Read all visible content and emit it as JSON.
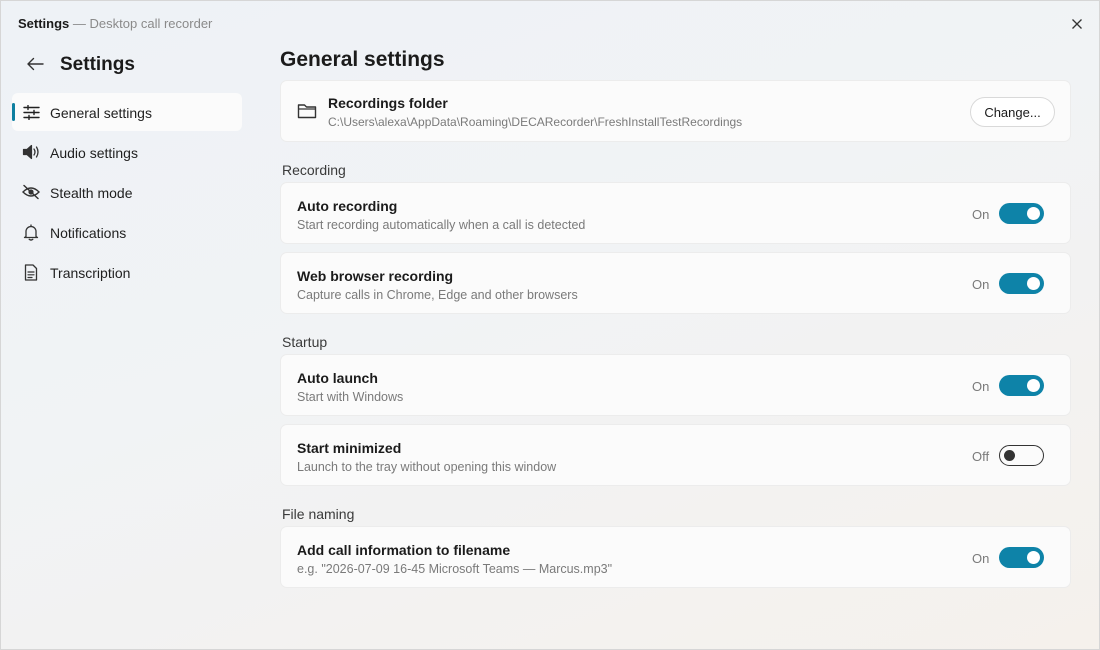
{
  "window": {
    "app_name": "Settings",
    "separator": "—",
    "subtitle": "Desktop call recorder"
  },
  "sidebar": {
    "title": "Settings",
    "items": [
      {
        "label": "General settings",
        "icon": "sliders-icon",
        "active": true
      },
      {
        "label": "Audio settings",
        "icon": "speaker-icon",
        "active": false
      },
      {
        "label": "Stealth mode",
        "icon": "eye-off-icon",
        "active": false
      },
      {
        "label": "Notifications",
        "icon": "bell-icon",
        "active": false
      },
      {
        "label": "Transcription",
        "icon": "document-icon",
        "active": false
      }
    ]
  },
  "main": {
    "title": "General settings",
    "folder": {
      "title": "Recordings folder",
      "path": "C:\\Users\\alexa\\AppData\\Roaming\\DECARecorder\\FreshInstallTestRecordings",
      "button": "Change..."
    },
    "sections": [
      {
        "label": "Recording",
        "items": [
          {
            "title": "Auto recording",
            "description": "Start recording automatically when a call is detected",
            "state": "On",
            "enabled": true
          },
          {
            "title": "Web browser recording",
            "description": "Capture calls in Chrome, Edge and other browsers",
            "state": "On",
            "enabled": true
          }
        ]
      },
      {
        "label": "Startup",
        "items": [
          {
            "title": "Auto launch",
            "description": "Start with Windows",
            "state": "On",
            "enabled": true
          },
          {
            "title": "Start minimized",
            "description": "Launch to the tray without opening this window",
            "state": "Off",
            "enabled": false
          }
        ]
      },
      {
        "label": "File naming",
        "items": [
          {
            "title": "Add call information to filename",
            "description": "e.g. \"2026-07-09 16-45 Microsoft Teams — Marcus.mp3\"",
            "state": "On",
            "enabled": true
          }
        ]
      }
    ]
  },
  "colors": {
    "accent": "#0e83a8",
    "card": "#fbfbfb",
    "muted_text": "#7a7a7a"
  }
}
